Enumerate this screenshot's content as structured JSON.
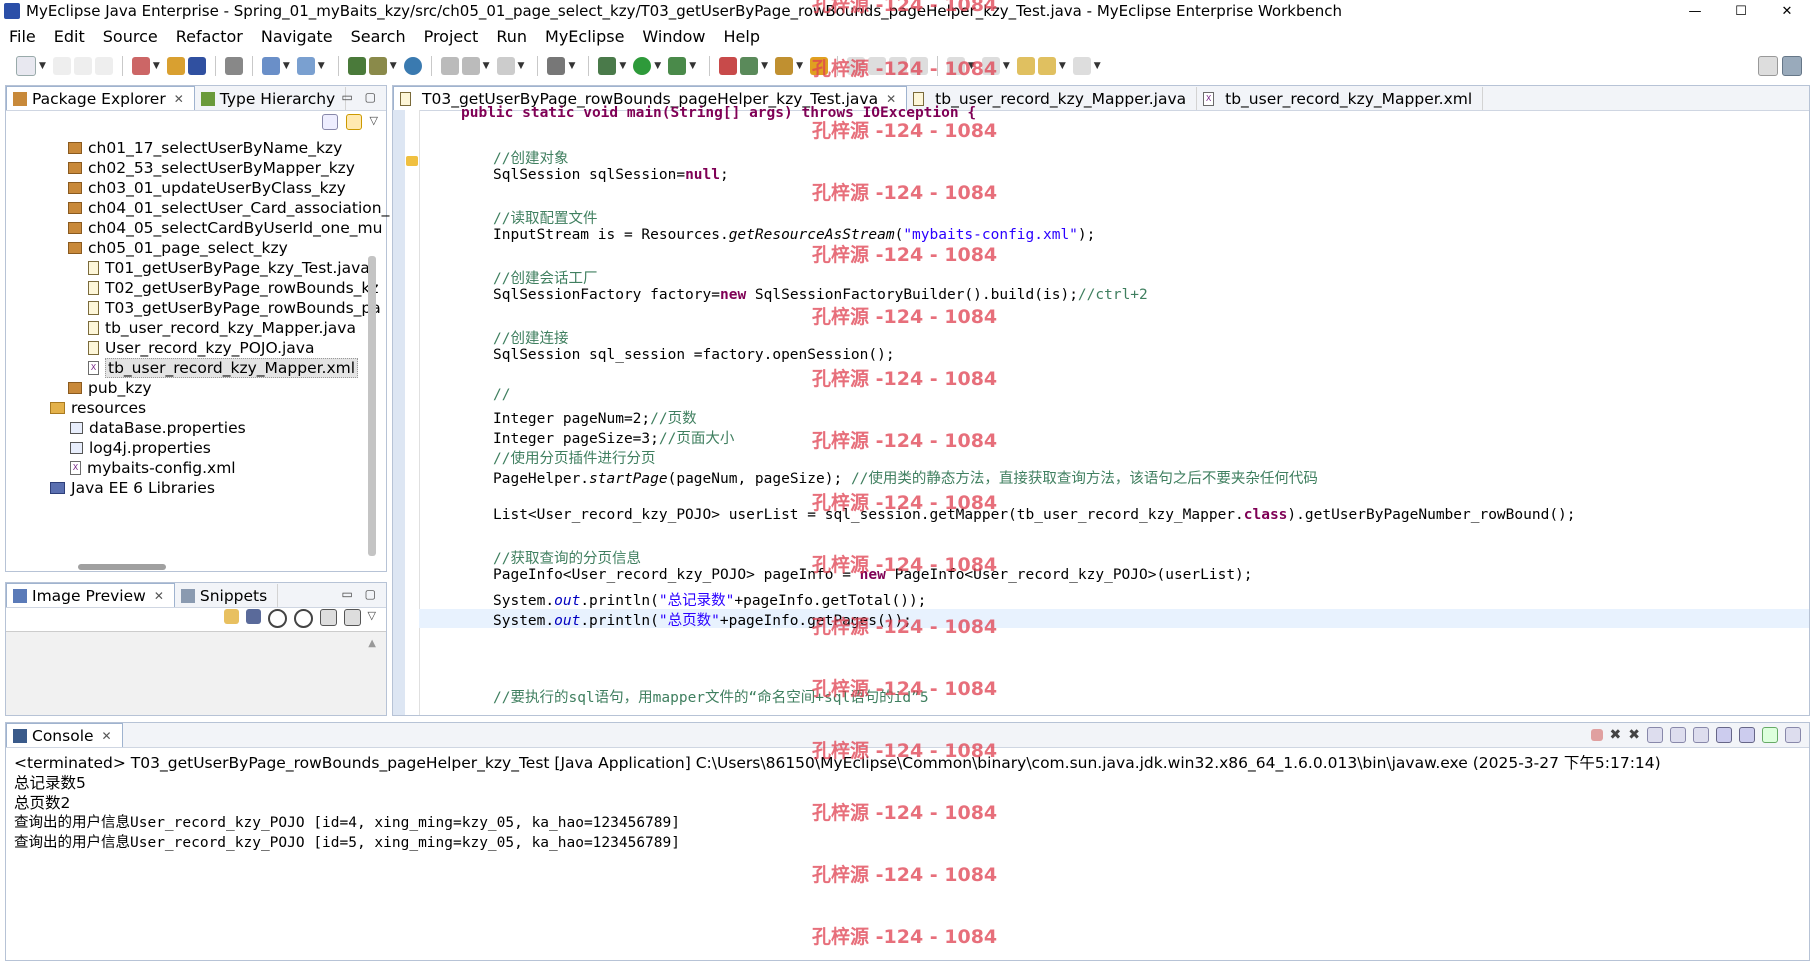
{
  "window": {
    "title": "MyEclipse Java Enterprise - Spring_01_myBaits_kzy/src/ch05_01_page_select_kzy/T03_getUserByPage_rowBounds_pageHelper_kzy_Test.java - MyEclipse Enterprise Workbench",
    "min_label": "—",
    "max_label": "☐",
    "close_label": "✕"
  },
  "menu": [
    "File",
    "Edit",
    "Source",
    "Refactor",
    "Navigate",
    "Search",
    "Project",
    "Run",
    "MyEclipse",
    "Window",
    "Help"
  ],
  "package_explorer": {
    "tabs": [
      {
        "label": "Package Explorer",
        "active": true
      },
      {
        "label": "Type Hierarchy",
        "active": false
      }
    ],
    "items": [
      {
        "label": "ch01_17_selectUserByName_kzy",
        "kind": "package",
        "level": 1
      },
      {
        "label": "ch02_53_selectUserByMapper_kzy",
        "kind": "package",
        "level": 1
      },
      {
        "label": "ch03_01_updateUserByClass_kzy",
        "kind": "package",
        "level": 1
      },
      {
        "label": "ch04_01_selectUser_Card_association_",
        "kind": "package",
        "level": 1
      },
      {
        "label": "ch04_05_selectCardByUserId_one_mu",
        "kind": "package",
        "level": 1
      },
      {
        "label": "ch05_01_page_select_kzy",
        "kind": "package",
        "level": 1
      },
      {
        "label": "T01_getUserByPage_kzy_Test.java",
        "kind": "java",
        "level": 2
      },
      {
        "label": "T02_getUserByPage_rowBounds_kz",
        "kind": "java",
        "level": 2
      },
      {
        "label": "T03_getUserByPage_rowBounds_pa",
        "kind": "java",
        "level": 2
      },
      {
        "label": "tb_user_record_kzy_Mapper.java",
        "kind": "java",
        "level": 2
      },
      {
        "label": "User_record_kzy_POJO.java",
        "kind": "java",
        "level": 2
      },
      {
        "label": "tb_user_record_kzy_Mapper.xml",
        "kind": "xml",
        "level": 2,
        "selected": true
      },
      {
        "label": "pub_kzy",
        "kind": "package",
        "level": 1
      },
      {
        "label": "resources",
        "kind": "folder",
        "level": 0
      },
      {
        "label": "dataBase.properties",
        "kind": "properties",
        "level": 1
      },
      {
        "label": "log4j.properties",
        "kind": "properties",
        "level": 1
      },
      {
        "label": "mybaits-config.xml",
        "kind": "xml",
        "level": 1
      },
      {
        "label": "Java EE 6 Libraries",
        "kind": "library",
        "level": 0
      }
    ]
  },
  "image_preview": {
    "tabs": [
      {
        "label": "Image Preview",
        "active": true
      },
      {
        "label": "Snippets",
        "active": false
      }
    ]
  },
  "editor": {
    "tabs": [
      {
        "label": "T03_getUserByPage_rowBounds_pageHelper_kzy_Test.java",
        "active": true
      },
      {
        "label": "tb_user_record_kzy_Mapper.java",
        "active": false
      },
      {
        "label": "tb_user_record_kzy_Mapper.xml",
        "active": false
      }
    ],
    "lines": {
      "l0": "public static void main(String[] args) throws IOException {",
      "c1": "//创建对象",
      "l1a": "SqlSession sqlSession=",
      "l1b": "null",
      "l1c": ";",
      "c2": "//读取配置文件",
      "l2a": "InputStream is = Resources.",
      "l2b": "getResourceAsStream",
      "l2c": "(",
      "l2d": "\"mybaits-config.xml\"",
      "l2e": ");",
      "c3": "//创建会话工厂",
      "l3a": "SqlSessionFactory factory=",
      "l3b": "new",
      "l3c": " SqlSessionFactoryBuilder().build(is);",
      "l3d": "//ctrl+2",
      "c4": "//创建连接",
      "l4": "SqlSession sql_session =factory.openSession();",
      "c5": "//",
      "l5a": "Integer pageNum=2;",
      "l5b": "//页数",
      "l6a": "Integer pageSize=3;",
      "l6b": "//页面大小",
      "c6": "//使用分页插件进行分页",
      "l7a": "PageHelper.",
      "l7b": "startPage",
      "l7c": "(pageNum, pageSize); ",
      "l7d": "//使用类的静态方法，直接获取查询方法，该语句之后不要夹杂任何代码",
      "l8a": "List<User_record_kzy_POJO> userList = sql_session.getMapper(tb_user_record_kzy_Mapper.",
      "l8b": "class",
      "l8c": ").getUserByPageNumber_rowBound();",
      "c7": "//获取查询的分页信息",
      "l9a": "PageInfo<User_record_kzy_POJO> pageInfo = ",
      "l9b": "new",
      "l9c": " PageInfo<User_record_kzy_POJO>(userList);",
      "l10a": "System.",
      "l10b": "out",
      "l10c": ".println(",
      "l10d": "\"总记录数\"",
      "l10e": "+pageInfo.getTotal());",
      "l11a": "System.",
      "l11b": "out",
      "l11c": ".println(",
      "l11d": "\"总页数\"",
      "l11e": "+pageInfo.getPages());",
      "c8": "//要执行的sql语句，用mapper文件的“命名空间+sql语句的id”5"
    }
  },
  "console": {
    "tab_label": "Console",
    "terminated": "<terminated> T03_getUserByPage_rowBounds_pageHelper_kzy_Test [Java Application] C:\\Users\\86150\\MyEclipse\\Common\\binary\\com.sun.java.jdk.win32.x86_64_1.6.0.013\\bin\\javaw.exe (2025-3-27 下午5:17:14)",
    "output": [
      "总记录数5",
      "总页数2",
      "查询出的用户信息User_record_kzy_POJO [id=4, xing_ming=kzy_05, ka_hao=123456789]",
      "查询出的用户信息User_record_kzy_POJO [id=5, xing_ming=kzy_05, ka_hao=123456789]"
    ]
  },
  "watermark": "孔梓源 -124 - 1084",
  "colors": {
    "comment": "#3f7f5f",
    "keyword": "#7f0055",
    "string": "#2a00ff",
    "field": "#0000c0",
    "watermark": "#e04050",
    "current_line": "#e8f2fe"
  }
}
